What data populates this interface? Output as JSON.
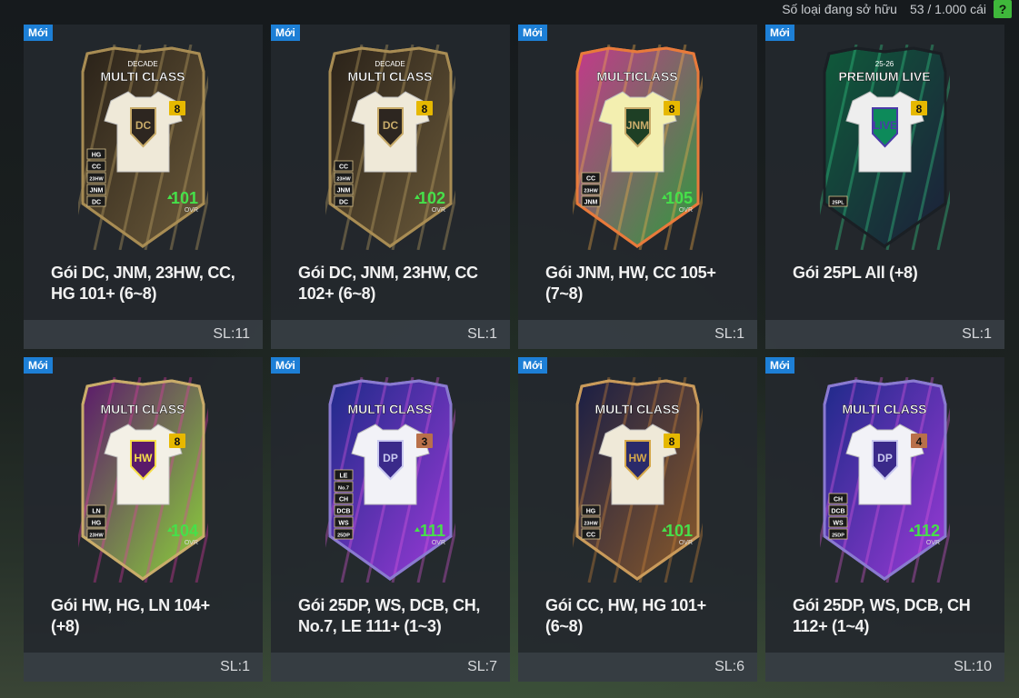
{
  "header": {
    "count_label": "Số loại đang sở hữu",
    "count_value": "53 / 1.000 cái",
    "help_label": "?"
  },
  "packs": [
    {
      "badge": "Mới",
      "name_line1": "Gói DC, JNM, 23HW, CC,",
      "name_line2": "HG 101+ (6~8)",
      "qty": "SL:11",
      "card": {
        "subtitle": "DECADE",
        "title": "MULTI CLASS",
        "level": "8",
        "ovr": "101",
        "ovr_label": "OVR",
        "emblem": "DC",
        "tags": [
          "HG",
          "CC",
          "23HW",
          "JNM",
          "DC"
        ],
        "theme": "gold",
        "level_color": "#e6b800"
      }
    },
    {
      "badge": "Mới",
      "name_line1": "Gói DC, JNM, 23HW, CC",
      "name_line2": "102+ (6~8)",
      "qty": "SL:1",
      "card": {
        "subtitle": "DECADE",
        "title": "MULTI CLASS",
        "level": "8",
        "ovr": "102",
        "ovr_label": "OVR",
        "emblem": "DC",
        "tags": [
          "CC",
          "23HW",
          "JNM",
          "DC"
        ],
        "theme": "gold",
        "level_color": "#e6b800"
      }
    },
    {
      "badge": "Mới",
      "name_line1": "Gói JNM, HW, CC 105+",
      "name_line2": "(7~8)",
      "qty": "SL:1",
      "card": {
        "subtitle": "",
        "title": "MULTICLASS",
        "level": "8",
        "ovr": "105",
        "ovr_label": "OVR",
        "emblem": "JNM",
        "tags": [
          "CC",
          "23HW",
          "JNM"
        ],
        "theme": "neon",
        "level_color": "#e6b800"
      }
    },
    {
      "badge": "Mới",
      "name_line1": "Gói 25PL All (+8)",
      "name_line2": "",
      "qty": "SL:1",
      "card": {
        "subtitle": "25-26",
        "title": "PREMIUM LIVE",
        "level": "8",
        "ovr": "",
        "ovr_label": "",
        "emblem": "LIVE",
        "tags": [
          "25PL"
        ],
        "theme": "live",
        "level_color": "#e6b800"
      }
    },
    {
      "badge": "Mới",
      "name_line1": "Gói HW, HG, LN 104+",
      "name_line2": "(+8)",
      "qty": "SL:1",
      "card": {
        "subtitle": "",
        "title": "MULTI CLASS",
        "level": "8",
        "ovr": "104",
        "ovr_label": "OVR",
        "emblem": "HW",
        "tags": [
          "LN",
          "HG",
          "23HW"
        ],
        "theme": "jungle",
        "level_color": "#e6b800"
      }
    },
    {
      "badge": "Mới",
      "name_line1": "Gói 25DP, WS, DCB, CH,",
      "name_line2": "No.7, LE 111+ (1~3)",
      "qty": "SL:7",
      "card": {
        "subtitle": "",
        "title": "MULTI CLASS",
        "level": "3",
        "ovr": "111",
        "ovr_label": "OVR",
        "emblem": "DP",
        "tags": [
          "LE",
          "No.7",
          "CH",
          "DCB",
          "WS",
          "25DP"
        ],
        "theme": "purple",
        "level_color": "#b9704a"
      }
    },
    {
      "badge": "Mới",
      "name_line1": "Gói CC, HW, HG 101+",
      "name_line2": "(6~8)",
      "qty": "SL:6",
      "card": {
        "subtitle": "",
        "title": "MULTI CLASS",
        "level": "8",
        "ovr": "101",
        "ovr_label": "OVR",
        "emblem": "HW",
        "tags": [
          "HG",
          "23HW",
          "CC"
        ],
        "theme": "bronze",
        "level_color": "#e6b800"
      }
    },
    {
      "badge": "Mới",
      "name_line1": "Gói 25DP, WS, DCB, CH",
      "name_line2": "112+ (1~4)",
      "qty": "SL:10",
      "card": {
        "subtitle": "",
        "title": "MULTI CLASS",
        "level": "4",
        "ovr": "112",
        "ovr_label": "OVR",
        "emblem": "DP",
        "tags": [
          "CH",
          "DCB",
          "WS",
          "25DP"
        ],
        "theme": "purple",
        "level_color": "#b9704a"
      }
    }
  ],
  "colors": {
    "badge_blue": "#1d7fd6",
    "help_green": "#3fb83b",
    "ovr_green": "#46e04a"
  }
}
